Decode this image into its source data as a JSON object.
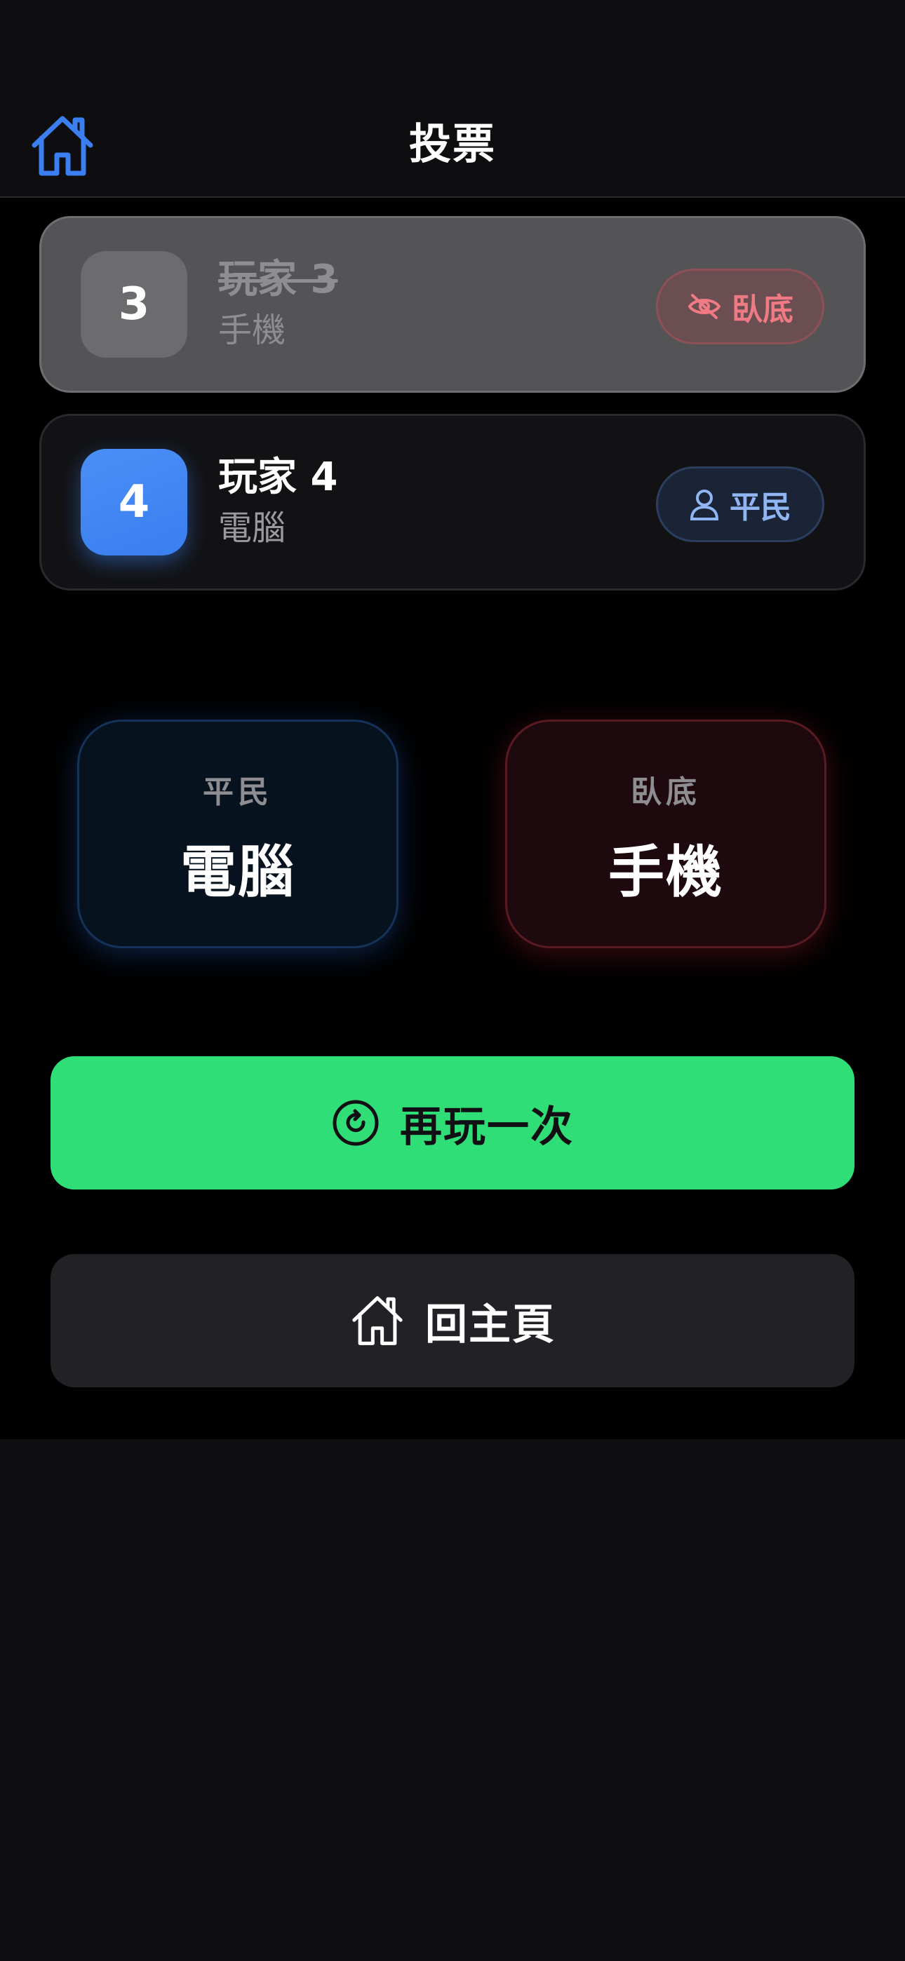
{
  "nav": {
    "title": "投票",
    "home_icon": "home-icon"
  },
  "players": [
    {
      "number": "3",
      "name": "玩家 3",
      "device": "手機",
      "status": "eliminated",
      "role_label": "臥底",
      "role_icon": "eye-slash-icon"
    },
    {
      "number": "4",
      "name": "玩家 4",
      "device": "電腦",
      "status": "active",
      "role_label": "平民",
      "role_icon": "person-icon"
    }
  ],
  "results": {
    "civilian": {
      "role": "平民",
      "word": "電腦"
    },
    "spy": {
      "role": "臥底",
      "word": "手機"
    }
  },
  "buttons": {
    "replay_label": "再玩一次",
    "replay_icon": "replay-icon",
    "home_label": "回主頁",
    "home_icon": "home-icon"
  },
  "colors": {
    "accent_blue": "#3a7ef0",
    "replay_green": "#30de78",
    "spy_red": "#f07a84",
    "civilian_blue": "#8fb6f2"
  }
}
